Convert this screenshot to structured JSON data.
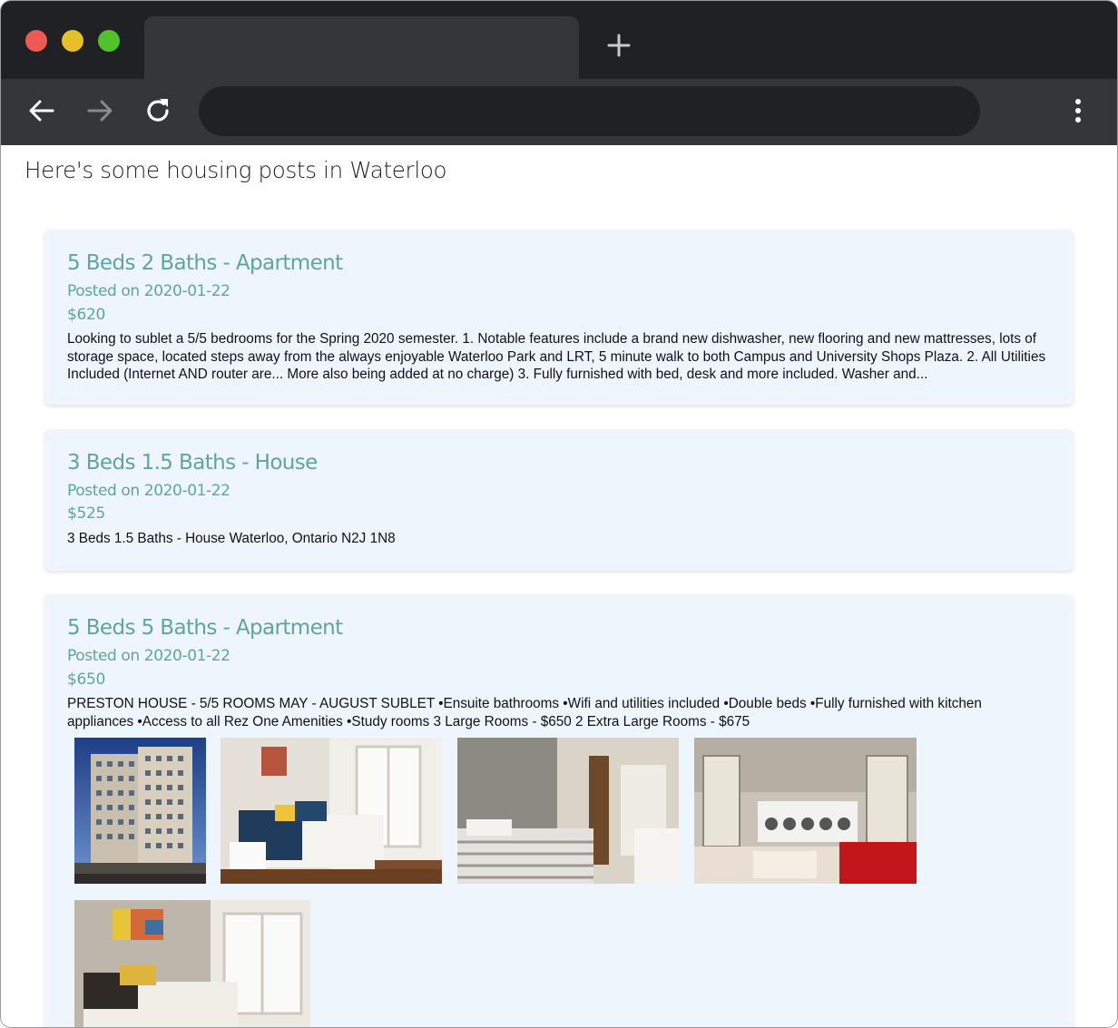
{
  "browser": {
    "tab_title": "",
    "address": ""
  },
  "page": {
    "title": "Here's some housing posts in Waterloo"
  },
  "posts": [
    {
      "title": "5 Beds 2 Baths - Apartment",
      "posted": "Posted on 2020-01-22",
      "price": "$620",
      "description": "Looking to sublet a 5/5 bedrooms for the Spring 2020 semester. 1. Notable features include a brand new dishwasher, new flooring and new mattresses, lots of storage space, located steps away from the always enjoyable Waterloo Park and LRT, 5 minute walk to both Campus and University Shops Plaza. 2. All Utilities Included (Internet AND router are... More also being added at no charge) 3. Fully furnished with bed, desk and more included. Washer and..."
    },
    {
      "title": "3 Beds 1.5 Baths - House",
      "posted": "Posted on 2020-01-22",
      "price": "$525",
      "description": "3 Beds 1.5 Baths - House Waterloo, Ontario N2J 1N8"
    },
    {
      "title": "5 Beds 5 Baths - Apartment",
      "posted": "Posted on 2020-01-22",
      "price": "$650",
      "description": "PRESTON HOUSE - 5/5 ROOMS MAY - AUGUST SUBLET •Ensuite bathrooms •Wifi and utilities included •Double beds •Fully furnished with kitchen appliances •Access to all Rez One Amenities •Study rooms 3 Large Rooms - $650 2 Extra Large Rooms - $675",
      "photos": [
        "building-exterior-photo",
        "bedroom-photo",
        "bedroom-photo",
        "laundry-lounge-photo",
        "bedroom-photo"
      ]
    }
  ],
  "icons": {
    "back": "arrow-left-icon",
    "forward": "arrow-right-icon",
    "reload": "reload-icon",
    "menu": "more-vertical-icon",
    "new_tab": "plus-icon"
  },
  "colors": {
    "accent": "#5ea59f",
    "card_bg": "#eef5fd",
    "chrome_dark": "#202124",
    "chrome_toolbar": "#35363a"
  }
}
